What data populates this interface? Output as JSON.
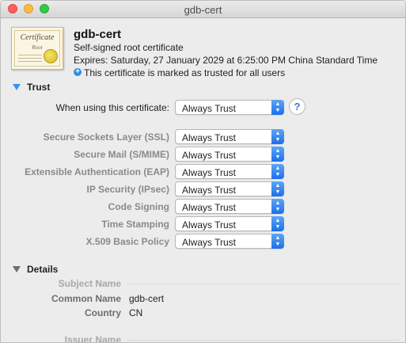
{
  "window": {
    "title": "gdb-cert"
  },
  "certificate": {
    "icon_title": "Certificate",
    "icon_subtitle": "Root",
    "name": "gdb-cert",
    "type": "Self-signed root certificate",
    "expires": "Expires: Saturday, 27 January 2029 at 6:25:00 PM China Standard Time",
    "trust_status": "This certificate is marked as trusted for all users"
  },
  "trust": {
    "heading": "Trust",
    "when_using_label": "When using this certificate:",
    "when_using_value": "Always Trust",
    "help_label": "?",
    "rows": [
      {
        "label": "Secure Sockets Layer (SSL)",
        "value": "Always Trust"
      },
      {
        "label": "Secure Mail (S/MIME)",
        "value": "Always Trust"
      },
      {
        "label": "Extensible Authentication (EAP)",
        "value": "Always Trust"
      },
      {
        "label": "IP Security (IPsec)",
        "value": "Always Trust"
      },
      {
        "label": "Code Signing",
        "value": "Always Trust"
      },
      {
        "label": "Time Stamping",
        "value": "Always Trust"
      },
      {
        "label": "X.509 Basic Policy",
        "value": "Always Trust"
      }
    ]
  },
  "details": {
    "heading": "Details",
    "subject_name_label": "Subject Name",
    "common_name_label": "Common Name",
    "common_name_value": "gdb-cert",
    "country_label": "Country",
    "country_value": "CN",
    "issuer_name_label": "Issuer Name"
  },
  "colors": {
    "accent": "#2f7de1",
    "close": "#fc605c",
    "minimize": "#fdbc40",
    "maximize": "#34c84a"
  },
  "icons": {
    "trust_disclosure": "disclosure-triangle-icon",
    "trusted_badge": "plus-circle-icon",
    "popup_arrows": "updown-chevron-icon"
  }
}
